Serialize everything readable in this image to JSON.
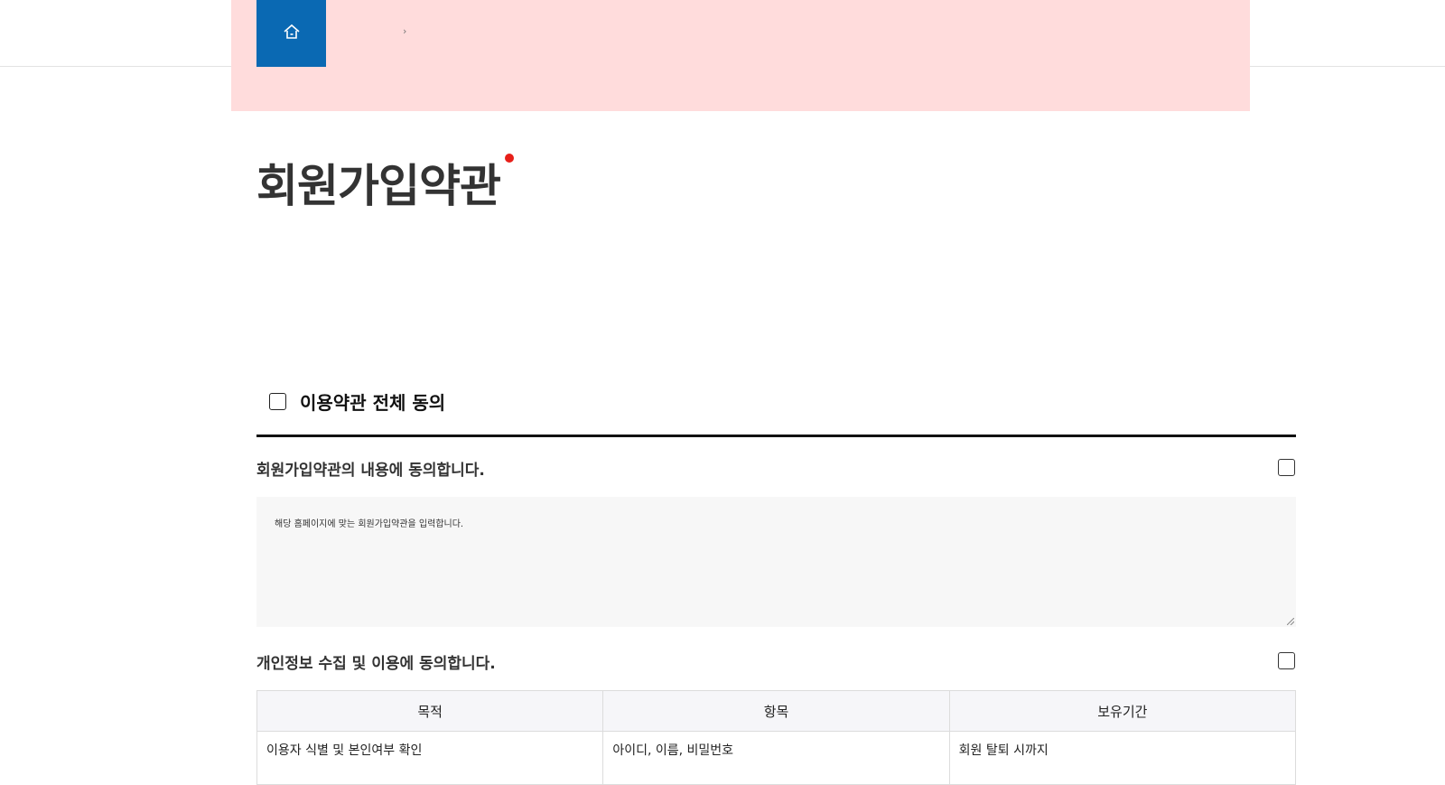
{
  "breadcrumb": {
    "home_icon": "home-icon",
    "separator": "›"
  },
  "page": {
    "title": "회원가입약관",
    "accent_color": "#e71f19"
  },
  "agree_all": {
    "label": "이용약관 전체 동의"
  },
  "sections": {
    "terms": {
      "title": "회원가입약관의 내용에 동의합니다.",
      "content": "해당 홈페이지에 맞는 회원가입약관을 입력합니다."
    },
    "privacy": {
      "title": "개인정보 수집 및 이용에 동의합니다.",
      "headers": [
        "목적",
        "항목",
        "보유기간"
      ],
      "rows": [
        [
          "이용자 식별 및 본인여부 확인",
          "아이디, 이름, 비밀번호",
          "회원 탈퇴 시까지"
        ]
      ]
    }
  },
  "colors": {
    "home_bg": "#0a69b3",
    "highlight_bg": "#ffdcdc"
  }
}
